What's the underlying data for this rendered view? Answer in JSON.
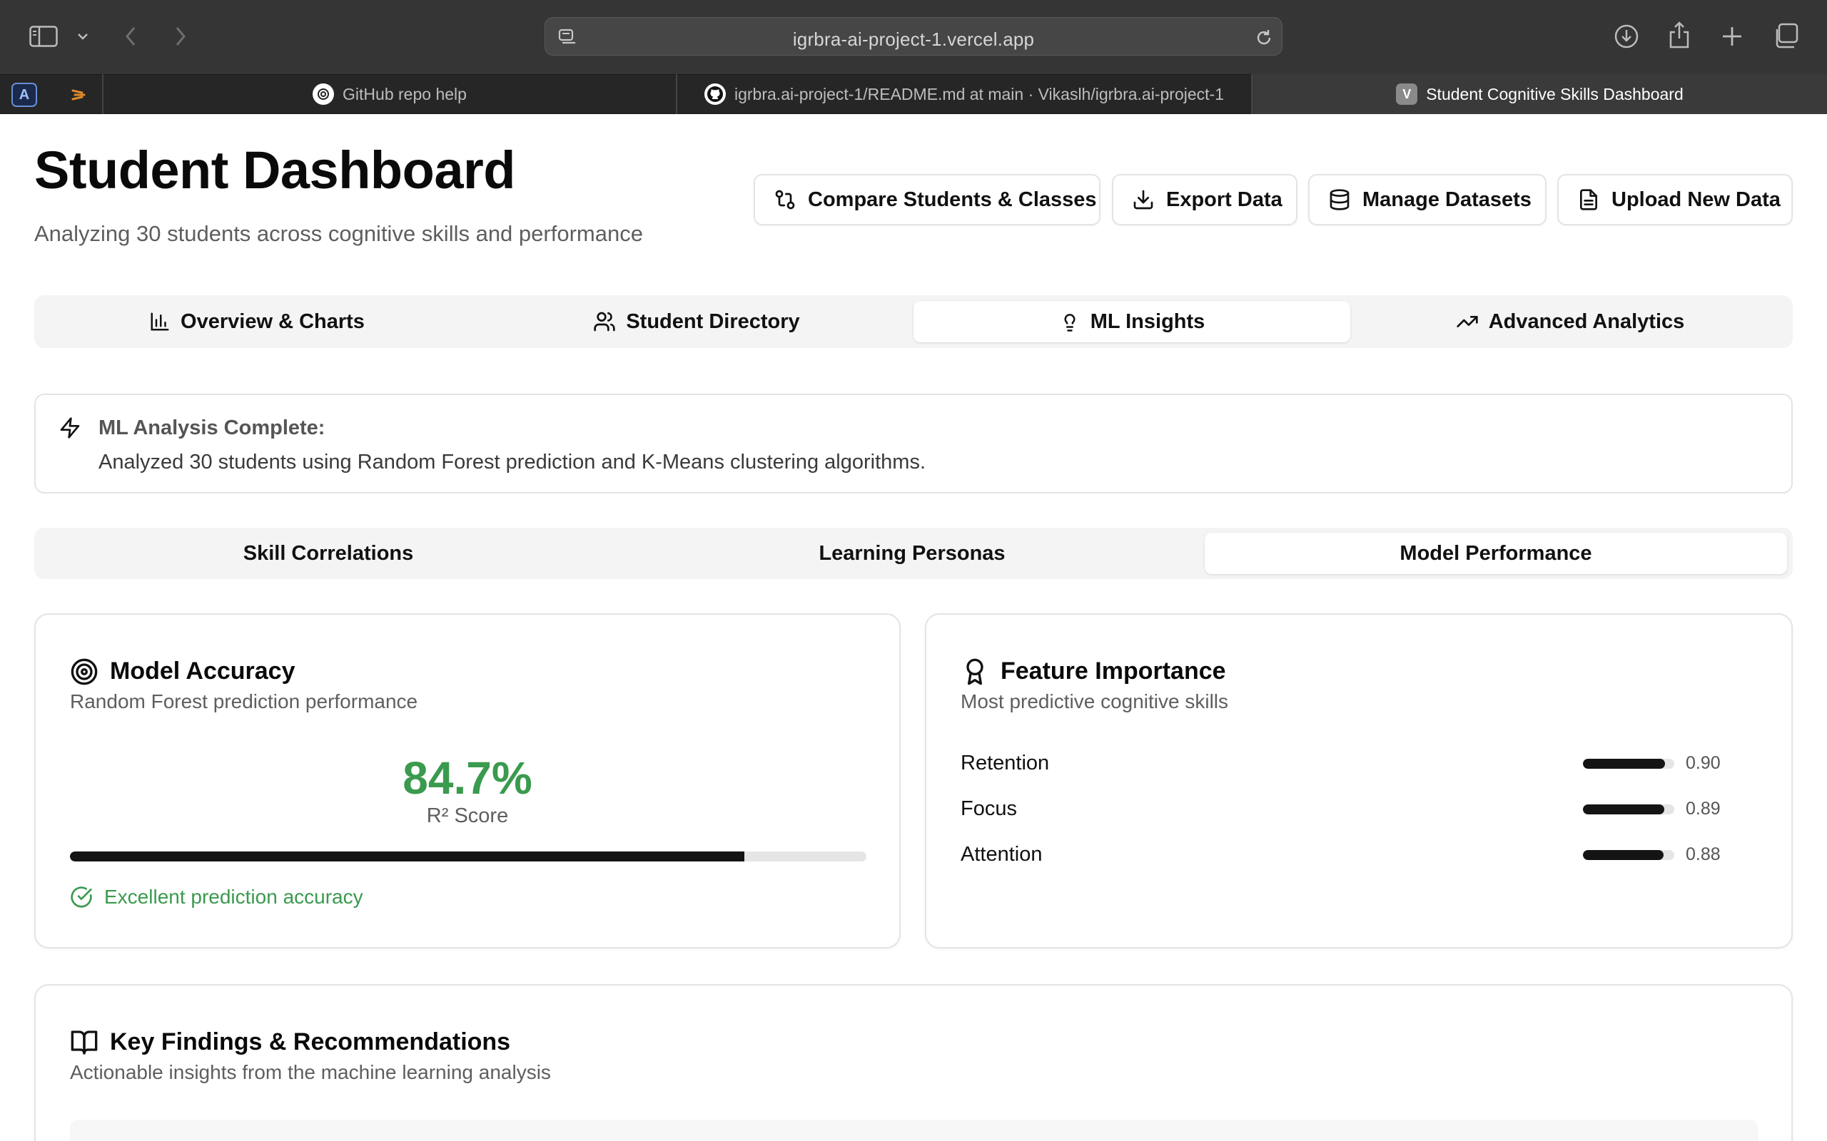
{
  "browser": {
    "url": "igrbra-ai-project-1.vercel.app",
    "tabs": [
      {
        "label": "GitHub repo help"
      },
      {
        "label": "igrbra.ai-project-1/README.md at main · Vikaslh/igrbra.ai-project-1"
      },
      {
        "label": "Student Cognitive Skills Dashboard",
        "favicon_letter": "V"
      }
    ],
    "pinned_tab_letter": "A"
  },
  "header": {
    "title": "Student Dashboard",
    "subtitle": "Analyzing 30 students across cognitive skills and performance",
    "buttons": [
      {
        "label": "Compare Students & Classes",
        "icon": "git-compare-icon"
      },
      {
        "label": "Export Data",
        "icon": "download-icon"
      },
      {
        "label": "Manage Datasets",
        "icon": "database-icon"
      },
      {
        "label": "Upload New Data",
        "icon": "file-text-icon"
      }
    ]
  },
  "main_tabs": [
    {
      "label": "Overview & Charts",
      "icon": "bar-chart-icon"
    },
    {
      "label": "Student Directory",
      "icon": "users-icon"
    },
    {
      "label": "ML Insights",
      "icon": "lightbulb-icon",
      "active": true
    },
    {
      "label": "Advanced Analytics",
      "icon": "trending-up-icon"
    }
  ],
  "alert": {
    "title": "ML Analysis Complete:",
    "body": "Analyzed 30 students using Random Forest prediction and K-Means clustering algorithms."
  },
  "sub_tabs": [
    {
      "label": "Skill Correlations"
    },
    {
      "label": "Learning Personas"
    },
    {
      "label": "Model Performance",
      "active": true
    }
  ],
  "model_accuracy": {
    "title": "Model Accuracy",
    "subtitle": "Random Forest prediction performance",
    "value": "84.7%",
    "value_fraction": 0.847,
    "metric_label": "R² Score",
    "note": "Excellent prediction accuracy"
  },
  "feature_importance": {
    "title": "Feature Importance",
    "subtitle": "Most predictive cognitive skills",
    "features": [
      {
        "name": "Retention",
        "value": "0.90",
        "score": 0.9
      },
      {
        "name": "Focus",
        "value": "0.89",
        "score": 0.89
      },
      {
        "name": "Attention",
        "value": "0.88",
        "score": 0.88
      }
    ]
  },
  "findings": {
    "title": "Key Findings & Recommendations",
    "subtitle": "Actionable insights from the machine learning analysis"
  },
  "colors": {
    "success": "#3a9a4e",
    "bar": "#141414",
    "chrome": "#353535"
  }
}
